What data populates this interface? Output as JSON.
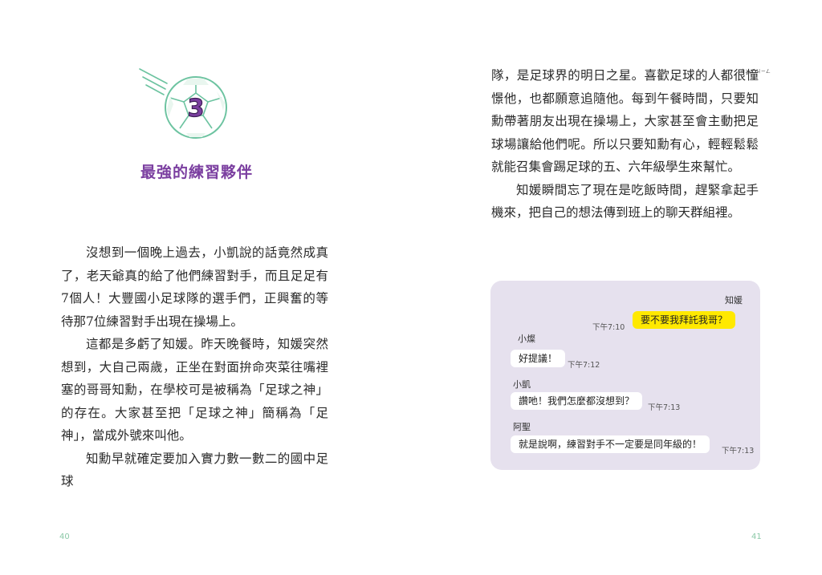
{
  "left_page": {
    "chapter_number": "3",
    "chapter_title": "最強的練習夥伴",
    "paragraphs": [
      "沒想到一個晚上過去，小凱說的話竟然成真了，老天爺真的給了他們練習對手，而且足足有7個人！大豐國小足球隊的選手們，正興奮的等待那7位練習對手出現在操場上。",
      "這都是多虧了知媛。昨天晚餐時，知媛突然想到，大自己兩歲，正坐在對面拚命夾菜往嘴裡塞的哥哥知勳，在學校可是被稱為「足球之神」的存在。大家甚至把「足球之神」簡稱為「足神」，當成外號來叫他。",
      "知勳早就確定要加入實力數一數二的國中足球"
    ],
    "page_number": "40"
  },
  "right_page": {
    "paragraphs": [
      "隊，是足球界的明日之星。喜歡足球的人都很憧憬他，也都願意追隨他。每到午餐時間，只要知勳帶著朋友出現在操場上，大家甚至會主動把足球場讓給他們呢。所以只要知勳有心，輕輕鬆鬆就能召集會踢足球的五、六年級學生來幫忙。",
      "知媛瞬間忘了現在是吃飯時間，趕緊拿起手機來，把自己的想法傳到班上的聊天群組裡。"
    ],
    "ruby": "ㄔㄨㄥ ㄐㄧㄥ",
    "page_number": "41",
    "chat": {
      "messages": [
        {
          "sender": "知媛",
          "text": "要不要我拜託我哥？",
          "time": "下午7:10"
        },
        {
          "sender": "小燦",
          "text": "好提議！",
          "time": "下午7:12"
        },
        {
          "sender": "小凱",
          "text": "讚吔！我們怎麼都沒想到？",
          "time": "下午7:13"
        },
        {
          "sender": "阿聖",
          "text": "就是說啊，練習對手不一定要是同年級的！",
          "time": "下午7:13"
        }
      ]
    }
  },
  "colors": {
    "title_purple": "#7b3fa0",
    "icon_green": "#6cc3a0",
    "chat_bg": "#e6e1ee",
    "my_bubble": "#ffe900",
    "page_number": "#8cc9a8"
  },
  "icons": [
    "soccer-ball-icon"
  ]
}
